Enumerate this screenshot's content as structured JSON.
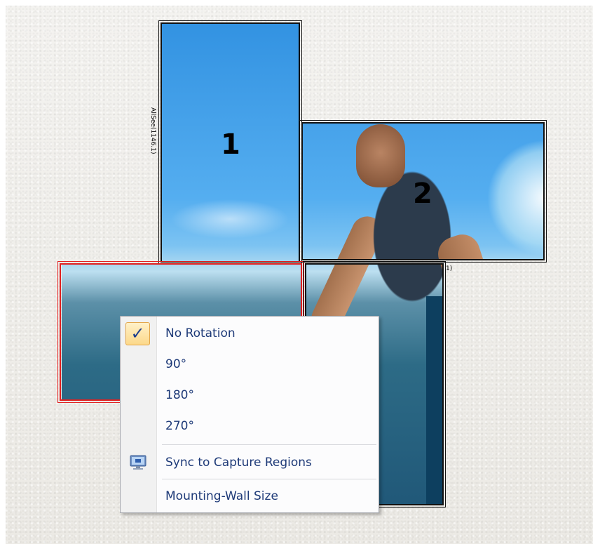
{
  "displays": [
    {
      "number": "1",
      "caption": "AllSee(1146.1)"
    },
    {
      "number": "2",
      "caption": ""
    },
    {
      "number": "",
      "caption": ""
    },
    {
      "number": "",
      "caption": "1)"
    }
  ],
  "context_menu": {
    "items": [
      {
        "label": "No Rotation",
        "checked": true,
        "icon": "checkmark-icon"
      },
      {
        "label": "90°"
      },
      {
        "label": "180°"
      },
      {
        "label": "270°"
      },
      {
        "label": "Sync to Capture Regions",
        "icon": "monitor-sync-icon"
      },
      {
        "label": "Mounting-Wall Size"
      }
    ],
    "check_glyph": "✓"
  },
  "colors": {
    "selection_outline": "#e02020",
    "display_outline": "#111111",
    "menu_text": "#1e3a78",
    "check_highlight": "#fcd88a"
  }
}
